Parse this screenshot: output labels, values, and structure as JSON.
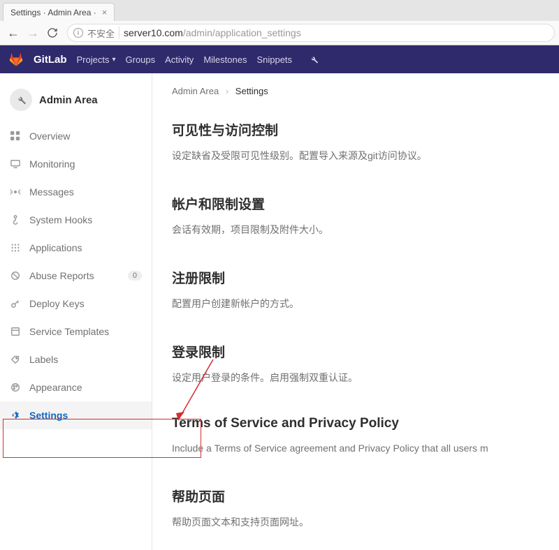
{
  "browser": {
    "tab_title": "Settings · Admin Area · ",
    "insecure_label": "不安全",
    "url_host": "server10.com",
    "url_path": "/admin/application_settings"
  },
  "topnav": {
    "brand": "GitLab",
    "projects": "Projects",
    "groups": "Groups",
    "activity": "Activity",
    "milestones": "Milestones",
    "snippets": "Snippets"
  },
  "sidebar": {
    "area_title": "Admin Area",
    "items": [
      {
        "label": "Overview"
      },
      {
        "label": "Monitoring"
      },
      {
        "label": "Messages"
      },
      {
        "label": "System Hooks"
      },
      {
        "label": "Applications"
      },
      {
        "label": "Abuse Reports",
        "badge": "0"
      },
      {
        "label": "Deploy Keys"
      },
      {
        "label": "Service Templates"
      },
      {
        "label": "Labels"
      },
      {
        "label": "Appearance"
      },
      {
        "label": "Settings"
      }
    ]
  },
  "breadcrumb": {
    "parent": "Admin Area",
    "current": "Settings"
  },
  "sections": [
    {
      "title": "可见性与访问控制",
      "desc": "设定缺省及受限可见性级别。配置导入来源及git访问协议。"
    },
    {
      "title": "帐户和限制设置",
      "desc": "会话有效期，项目限制及附件大小。"
    },
    {
      "title": "注册限制",
      "desc": "配置用户创建新帐户的方式。"
    },
    {
      "title": "登录限制",
      "desc": "设定用户登录的条件。启用强制双重认证。"
    },
    {
      "title": "Terms of Service and Privacy Policy",
      "desc": "Include a Terms of Service agreement and Privacy Policy that all users m"
    },
    {
      "title": "帮助页面",
      "desc": "帮助页面文本和支持页面网址。"
    }
  ]
}
